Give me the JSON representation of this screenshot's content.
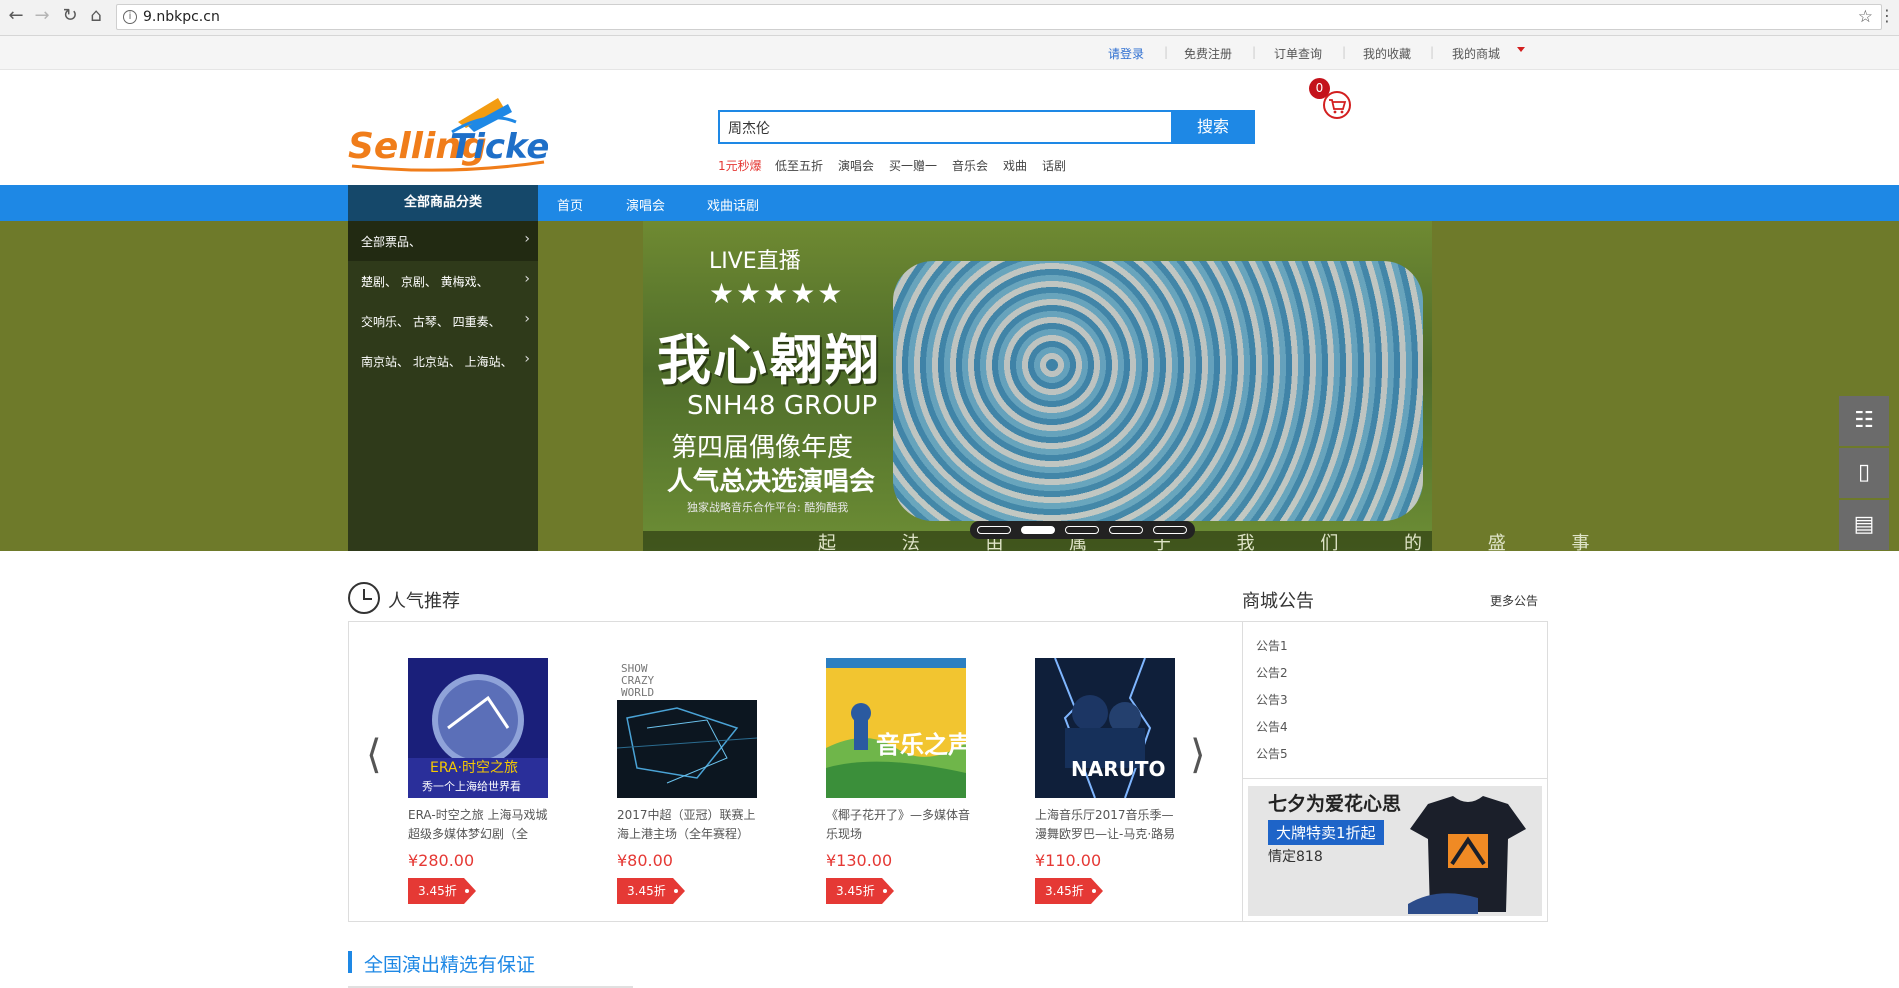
{
  "browser": {
    "url": "9.nbkpc.cn",
    "info_icon": "i"
  },
  "toplinks": {
    "login": "请登录",
    "register": "免费注册",
    "orders": "订单查询",
    "favorites": "我的收藏",
    "my_mall": "我的商城"
  },
  "header": {
    "search_value": "周杰伦",
    "search_button": "搜索",
    "hotwords": [
      "1元秒爆",
      "低至五折",
      "演唱会",
      "买一赠一",
      "音乐会",
      "戏曲",
      "话剧"
    ],
    "cart_count": "0"
  },
  "nav": {
    "category_title": "全部商品分类",
    "items": [
      "首页",
      "演唱会",
      "戏曲话剧"
    ]
  },
  "categories": [
    "全部票品、",
    "楚剧、  京剧、  黄梅戏、",
    "交响乐、  古琴、  四重奏、",
    "南京站、  北京站、  上海站、"
  ],
  "banner": {
    "live": "LIVE直播",
    "stars": "★★★★★",
    "headline": "我心翱翔",
    "group": "SNH48 GROUP",
    "line1": "第四届偶像年度",
    "line2": "人气总决选演唱会",
    "partner": "独家战略音乐合作平台: 酷狗酷我",
    "strip_text": "起 法 由 属 于 我 们 的 盛 事",
    "active_slide": 2,
    "slides": 5
  },
  "recommend": {
    "title": "人气推荐",
    "products": [
      {
        "name": "ERA-时空之旅 上海马戏城超级多媒体梦幻剧（全",
        "price": "¥280.00",
        "tag": "3.45折"
      },
      {
        "name": "2017中超（亚冠）联赛上海上港主场（全年赛程）",
        "price": "¥80.00",
        "tag": "3.45折"
      },
      {
        "name": "《椰子花开了》—多媒体音乐现场",
        "price": "¥130.00",
        "tag": "3.45折"
      },
      {
        "name": "上海音乐厅2017音乐季—漫舞欧罗巴—让-马克·路易",
        "price": "¥110.00",
        "tag": "3.45折"
      }
    ]
  },
  "notice": {
    "title": "商城公告",
    "more": "更多公告",
    "items": [
      "公告1",
      "公告2",
      "公告3",
      "公告4",
      "公告5"
    ],
    "ad_title": "七夕为爱花心思",
    "ad_badge": "大牌特卖1折起",
    "ad_sub": "情定818"
  },
  "section2": {
    "title": "全国演出精选有保证"
  },
  "colors": {
    "primary": "#1e88e5",
    "price_red": "#e53935",
    "banner_bg": "#6e7a2a",
    "category_bg": "#2f3a1a"
  }
}
